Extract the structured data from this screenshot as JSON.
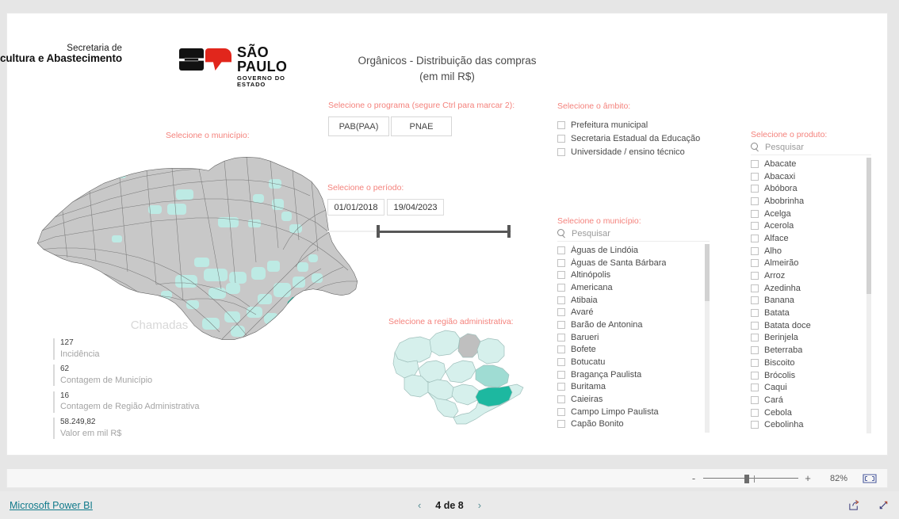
{
  "report": {
    "title": "Orgânicos - Distribuição das compras (em mil R$)",
    "logo": {
      "line1": "Secretaria de",
      "line2": "Agricultura e Abastecimento",
      "brand": "SÃO PAULO",
      "brand_sub": "GOVERNO DO ESTADO"
    }
  },
  "programa": {
    "heading": "Selecione o programa (segure Ctrl para marcar 2):",
    "options": [
      "PAB(PAA)",
      "PNAE"
    ]
  },
  "periodo": {
    "heading": "Selecione o período:",
    "start": "01/01/2018",
    "end": "19/04/2023"
  },
  "ambito": {
    "heading": "Selecione o âmbito:",
    "options": [
      "Prefeitura municipal",
      "Secretaria Estadual da Educação",
      "Universidade / ensino técnico"
    ]
  },
  "municipio_map": {
    "heading": "Selecione o município:"
  },
  "regiao_map": {
    "heading": "Selecione a região administrativa:"
  },
  "municipio": {
    "heading": "Selecione o município:",
    "search_placeholder": "Pesquisar",
    "options": [
      "Águas de Lindóia",
      "Águas de Santa Bárbara",
      "Altinópolis",
      "Americana",
      "Atibaia",
      "Avaré",
      "Barão de Antonina",
      "Barueri",
      "Bofete",
      "Botucatu",
      "Bragança Paulista",
      "Buritama",
      "Caieiras",
      "Campo Limpo Paulista",
      "Capão Bonito"
    ]
  },
  "produto": {
    "heading": "Selecione o produto:",
    "search_placeholder": "Pesquisar",
    "options": [
      "Abacate",
      "Abacaxi",
      "Abóbora",
      "Abobrinha",
      "Acelga",
      "Acerola",
      "Alface",
      "Alho",
      "Almeirão",
      "Arroz",
      "Azedinha",
      "Banana",
      "Batata",
      "Batata doce",
      "Berinjela",
      "Beterraba",
      "Biscoito",
      "Brócolis",
      "Caqui",
      "Cará",
      "Cebola",
      "Cebolinha"
    ]
  },
  "kpi": {
    "title": "Chamadas",
    "items": [
      {
        "value": "127",
        "label": "Incidência"
      },
      {
        "value": "62",
        "label": "Contagem de Município"
      },
      {
        "value": "16",
        "label": "Contagem de Região Administrativa"
      },
      {
        "value": "58.249,82",
        "label": "Valor em mil R$"
      }
    ]
  },
  "zoom_bar": {
    "minus": "-",
    "plus": "+",
    "percent": "82%",
    "fit_icon": "fit-to-page-icon"
  },
  "footer": {
    "brand": "Microsoft Power BI",
    "prev_icon": "chevron-left-icon",
    "next_icon": "chevron-right-icon",
    "page_label": "4 de 8",
    "share_icon": "share-icon",
    "fullscreen_icon": "fullscreen-icon"
  },
  "colors": {
    "accent_heading": "#f4827c",
    "map_base": "#c8c8c8",
    "map_highlight_light": "#bdeae4",
    "map_highlight_mid": "#8ad8cf",
    "map_highlight_dark": "#1db8a0",
    "link": "#117a8b"
  }
}
